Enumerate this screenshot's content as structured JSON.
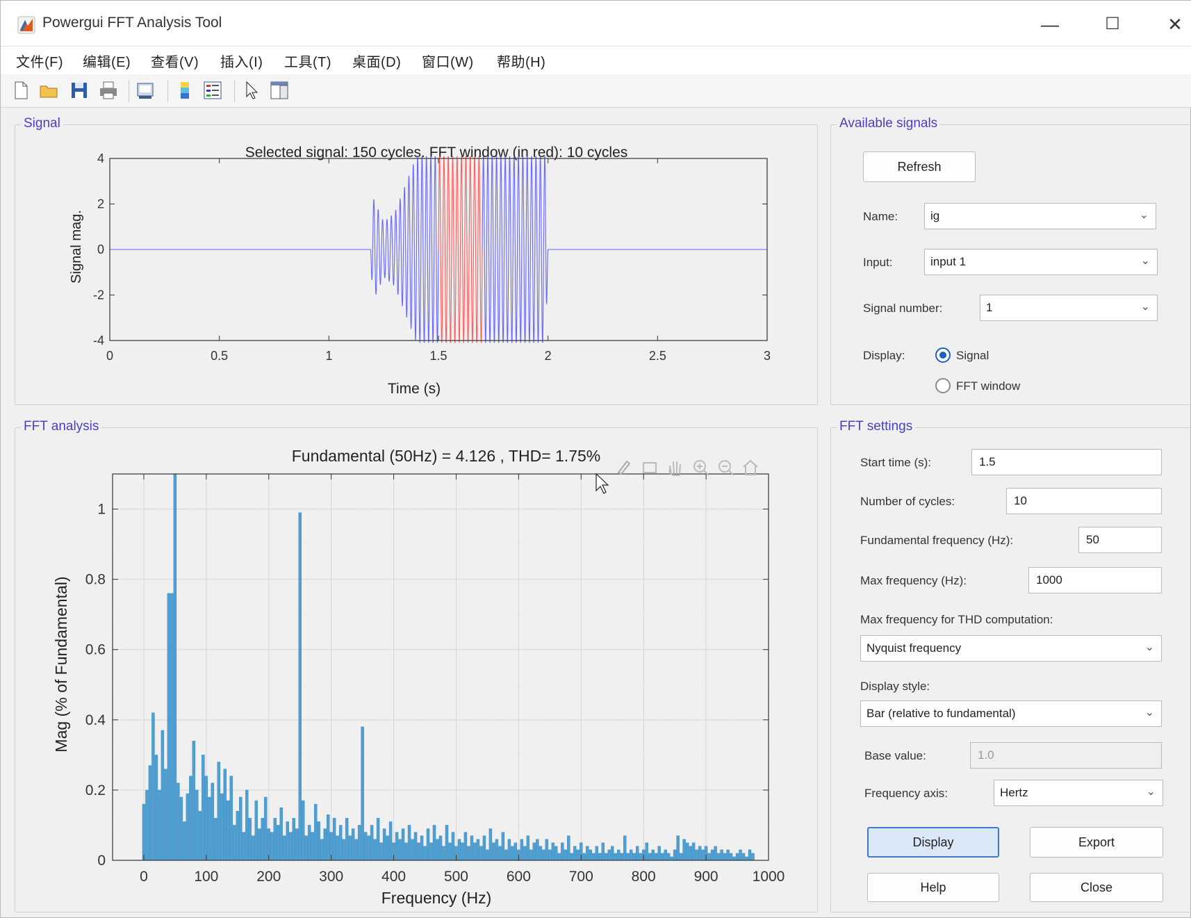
{
  "window": {
    "title": "Powergui FFT Analysis Tool",
    "controls": [
      "—",
      "☐",
      "✕"
    ]
  },
  "menubar": [
    "文件(F)",
    "编辑(E)",
    "查看(V)",
    "插入(I)",
    "工具(T)",
    "桌面(D)",
    "窗口(W)",
    "帮助(H)"
  ],
  "toolbar": [
    "new-file",
    "open-folder",
    "save",
    "print",
    "print-preview",
    "colorbar",
    "legend",
    "pointer",
    "property-editor"
  ],
  "signal_panel": {
    "title": "Signal",
    "plot": {
      "title": "Selected signal: 150 cycles. FFT window (in red): 10 cycles",
      "xlabel": "Time (s)",
      "ylabel": "Signal mag.",
      "xticks": [
        "0",
        "0.5",
        "1",
        "1.5",
        "2",
        "2.5",
        "3"
      ],
      "yticks": [
        "4",
        "2",
        "0",
        "-2",
        "-4"
      ]
    }
  },
  "available_signals": {
    "title": "Available signals",
    "refresh": "Refresh",
    "name_label": "Name:",
    "name_value": "ig",
    "input_label": "Input:",
    "input_value": "input 1",
    "signal_number_label": "Signal number:",
    "signal_number_value": "1",
    "display_label": "Display:",
    "display_options": [
      "Signal",
      "FFT window"
    ],
    "display_selected": "Signal"
  },
  "fft_panel": {
    "title": "FFT analysis",
    "plot": {
      "title": "Fundamental (50Hz) = 4.126 , THD= 1.75%",
      "xlabel": "Frequency (Hz)",
      "ylabel": "Mag (% of Fundamental)",
      "xticks": [
        "0",
        "100",
        "200",
        "300",
        "400",
        "500",
        "600",
        "700",
        "800",
        "900",
        "1000"
      ],
      "yticks": [
        "1",
        "0.8",
        "0.6",
        "0.4",
        "0.2",
        "0"
      ]
    }
  },
  "fft_settings": {
    "title": "FFT settings",
    "start_time_label": "Start time (s):",
    "start_time": "1.5",
    "cycles_label": "Number of cycles:",
    "cycles": "10",
    "fund_freq_label": "Fundamental frequency (Hz):",
    "fund_freq": "50",
    "max_freq_label": "Max frequency (Hz):",
    "max_freq": "1000",
    "thd_label": "Max frequency for THD computation:",
    "thd_value": "Nyquist frequency",
    "display_style_label": "Display style:",
    "display_style": "Bar (relative to fundamental)",
    "base_value_label": "Base value:",
    "base_value": "1.0",
    "freq_axis_label": "Frequency axis:",
    "freq_axis": "Hertz",
    "buttons": {
      "display": "Display",
      "export": "Export",
      "help": "Help",
      "close": "Close"
    }
  },
  "colors": {
    "accent": "#4a3fc4",
    "signal": "#6666ff",
    "fft_window": "#ff5a5a",
    "bars": "#4f9fd1"
  },
  "chart_data": [
    {
      "type": "line",
      "title": "Selected signal: 150 cycles. FFT window (in red): 10 cycles",
      "xlabel": "Time (s)",
      "ylabel": "Signal mag.",
      "xlim": [
        0,
        3
      ],
      "ylim": [
        -4,
        4
      ],
      "series": [
        {
          "name": "signal",
          "envelope": {
            "t": [
              0,
              1.19,
              1.2,
              1.25,
              1.3,
              1.4,
              1.5,
              1.7,
              1.99,
              2.0,
              3.0
            ],
            "amp": [
              0,
              0,
              2.3,
              1.2,
              1.6,
              4.1,
              4.1,
              4.1,
              4.1,
              0,
              0
            ]
          }
        },
        {
          "name": "fft-window",
          "t_start": 1.5,
          "t_end": 1.7
        }
      ],
      "grid": false
    },
    {
      "type": "bar",
      "title": "Fundamental (50Hz) = 4.126 , THD= 1.75%",
      "xlabel": "Frequency (Hz)",
      "ylabel": "Mag (% of Fundamental)",
      "xlim": [
        -50,
        1000
      ],
      "ylim": [
        0,
        1.1
      ],
      "x": [
        0,
        5,
        10,
        15,
        20,
        25,
        30,
        35,
        40,
        45,
        50,
        55,
        60,
        65,
        70,
        75,
        80,
        85,
        90,
        95,
        100,
        105,
        110,
        115,
        120,
        125,
        130,
        135,
        140,
        145,
        150,
        155,
        160,
        165,
        170,
        175,
        180,
        185,
        190,
        195,
        200,
        205,
        210,
        215,
        220,
        225,
        230,
        235,
        240,
        245,
        250,
        255,
        260,
        265,
        270,
        275,
        280,
        285,
        290,
        295,
        300,
        305,
        310,
        315,
        320,
        325,
        330,
        335,
        340,
        345,
        350,
        355,
        360,
        365,
        370,
        375,
        380,
        385,
        390,
        395,
        400,
        405,
        410,
        415,
        420,
        425,
        430,
        435,
        440,
        445,
        450,
        455,
        460,
        465,
        470,
        475,
        480,
        485,
        490,
        495,
        500,
        505,
        510,
        515,
        520,
        525,
        530,
        535,
        540,
        545,
        550,
        555,
        560,
        565,
        570,
        575,
        580,
        585,
        590,
        595,
        600,
        605,
        610,
        615,
        620,
        625,
        630,
        635,
        640,
        645,
        650,
        655,
        660,
        665,
        670,
        675,
        680,
        685,
        690,
        695,
        700,
        705,
        710,
        715,
        720,
        725,
        730,
        735,
        740,
        745,
        750,
        755,
        760,
        765,
        770,
        775,
        780,
        785,
        790,
        795,
        800,
        805,
        810,
        815,
        820,
        825,
        830,
        835,
        840,
        845,
        850,
        855,
        860,
        865,
        870,
        875,
        880,
        885,
        890,
        895,
        900,
        905,
        910,
        915,
        920,
        925,
        930,
        935,
        940,
        945,
        950,
        955,
        960,
        965,
        970,
        975,
        980,
        985,
        990,
        995,
        1000
      ],
      "values": [
        0.16,
        0.2,
        0.27,
        0.42,
        0.3,
        0.2,
        0.37,
        0.26,
        0.76,
        0.76,
        1.1,
        0.22,
        0.18,
        0.11,
        0.19,
        0.24,
        0.34,
        0.2,
        0.14,
        0.3,
        0.24,
        0.18,
        0.22,
        0.12,
        0.28,
        0.19,
        0.26,
        0.17,
        0.24,
        0.1,
        0.14,
        0.18,
        0.08,
        0.2,
        0.12,
        0.07,
        0.17,
        0.09,
        0.12,
        0.18,
        0.09,
        0.08,
        0.12,
        0.1,
        0.15,
        0.07,
        0.11,
        0.08,
        0.12,
        0.09,
        0.99,
        0.17,
        0.07,
        0.1,
        0.08,
        0.16,
        0.11,
        0.06,
        0.09,
        0.13,
        0.08,
        0.12,
        0.07,
        0.1,
        0.06,
        0.12,
        0.07,
        0.09,
        0.06,
        0.1,
        0.38,
        0.08,
        0.07,
        0.1,
        0.06,
        0.12,
        0.05,
        0.09,
        0.07,
        0.11,
        0.05,
        0.08,
        0.06,
        0.09,
        0.05,
        0.1,
        0.06,
        0.08,
        0.05,
        0.07,
        0.04,
        0.09,
        0.05,
        0.1,
        0.06,
        0.07,
        0.04,
        0.1,
        0.05,
        0.08,
        0.04,
        0.06,
        0.05,
        0.08,
        0.04,
        0.07,
        0.05,
        0.06,
        0.04,
        0.07,
        0.03,
        0.09,
        0.05,
        0.06,
        0.04,
        0.08,
        0.03,
        0.06,
        0.04,
        0.05,
        0.03,
        0.06,
        0.04,
        0.07,
        0.03,
        0.05,
        0.06,
        0.04,
        0.03,
        0.06,
        0.03,
        0.05,
        0.04,
        0.02,
        0.05,
        0.03,
        0.07,
        0.02,
        0.04,
        0.03,
        0.05,
        0.02,
        0.04,
        0.03,
        0.02,
        0.04,
        0.02,
        0.05,
        0.02,
        0.03,
        0.04,
        0.02,
        0.03,
        0.02,
        0.07,
        0.02,
        0.03,
        0.02,
        0.04,
        0.02,
        0.03,
        0.05,
        0.02,
        0.03,
        0.02,
        0.04,
        0.02,
        0.03,
        0.02,
        0.01,
        0.03,
        0.07,
        0.02,
        0.06,
        0.05,
        0.04,
        0.05,
        0.03,
        0.04,
        0.03,
        0.04,
        0.02,
        0.03,
        0.04,
        0.02,
        0.03,
        0.02,
        0.03,
        0.02,
        0.01,
        0.02,
        0.03,
        0.02,
        0.01,
        0.03,
        0.02
      ],
      "grid": true
    }
  ]
}
